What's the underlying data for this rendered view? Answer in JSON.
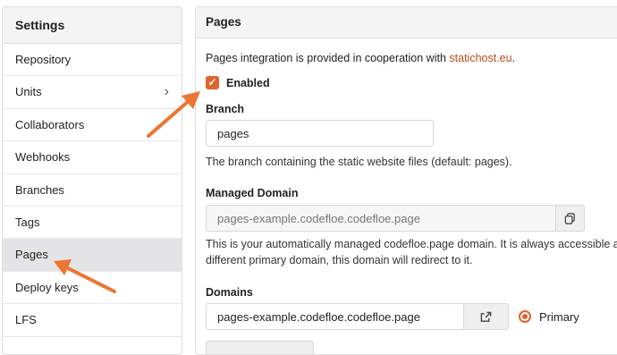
{
  "sidebar": {
    "title": "Settings",
    "items": [
      {
        "label": "Repository"
      },
      {
        "label": "Units",
        "has_chevron": true
      },
      {
        "label": "Collaborators"
      },
      {
        "label": "Webhooks"
      },
      {
        "label": "Branches"
      },
      {
        "label": "Tags"
      },
      {
        "label": "Pages",
        "active": true
      },
      {
        "label": "Deploy keys"
      },
      {
        "label": "LFS"
      }
    ],
    "chevron": "›"
  },
  "main": {
    "header": "Pages",
    "intro_text": "Pages integration is provided in cooperation with ",
    "intro_link": "statichost.eu",
    "intro_end": ".",
    "enabled_label": "Enabled",
    "enabled_checked": true,
    "branch": {
      "label": "Branch",
      "value": "pages",
      "help": "The branch containing the static website files (default: pages)."
    },
    "managed_domain": {
      "label": "Managed Domain",
      "value": "pages-example.codefloe.codefloe.page",
      "help_line1": "This is your automatically managed codefloe.page domain. It is always accessible an",
      "help_line2": "different primary domain, this domain will redirect to it."
    },
    "domains": {
      "label": "Domains",
      "value": "pages-example.codefloe.codefloe.page",
      "primary_label": "Primary"
    }
  },
  "colors": {
    "accent": "#e0642b",
    "link": "#b94a1e",
    "arrow": "#ec7532"
  },
  "icons": [
    "chevron-right-icon",
    "check-icon",
    "copy-icon",
    "external-link-icon"
  ]
}
